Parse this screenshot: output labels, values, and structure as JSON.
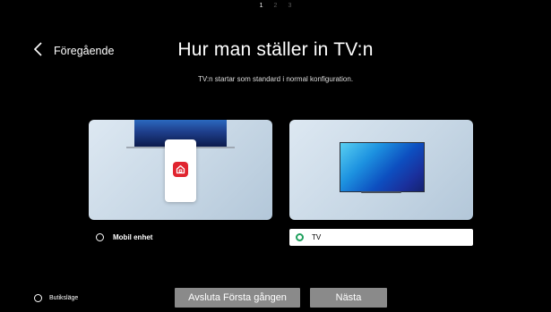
{
  "steps": {
    "items": [
      "1",
      "2",
      "3"
    ],
    "active_index": 0
  },
  "header": {
    "back_label": "Föregående",
    "title": "Hur man ställer in TV:n",
    "subtitle": "TV:n startar som standard i normal konfiguration."
  },
  "options": {
    "mobile": {
      "label": "Mobil enhet",
      "selected": false
    },
    "tv": {
      "label": "TV",
      "selected": true
    }
  },
  "store_mode": {
    "label": "Butiksläge",
    "selected": false
  },
  "buttons": {
    "exit": "Avsluta Första gången",
    "next": "Nästa"
  },
  "icons": {
    "back": "chevron-left-icon",
    "app": "lg-thinq-home-icon",
    "radio_selected_color": "#1fa05d"
  }
}
